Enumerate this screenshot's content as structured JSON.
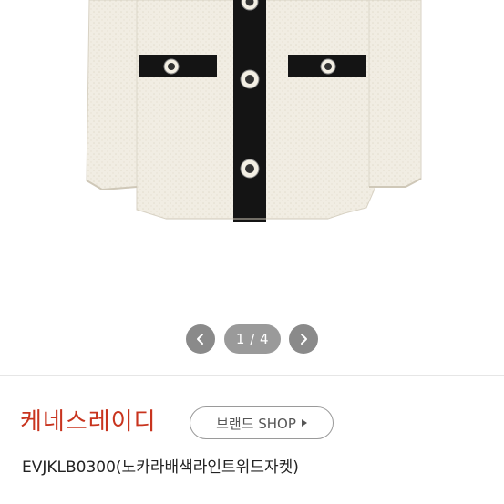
{
  "product": {
    "image_alt": "tweed jacket",
    "colors": {
      "fabric": "#f1ede3",
      "trim": "#141414",
      "button": "#f3efe4"
    }
  },
  "carousel": {
    "counter": "1 / 4",
    "prev_icon": "chevron-left-icon",
    "next_icon": "chevron-right-icon"
  },
  "brand": {
    "name": "케네스레이디",
    "shop_label": "브랜드 SHOP",
    "shop_icon": "caret-right-icon",
    "color": "#c8341e"
  },
  "title": "EVJKLB0300(노카라배색라인트위드자켓)"
}
